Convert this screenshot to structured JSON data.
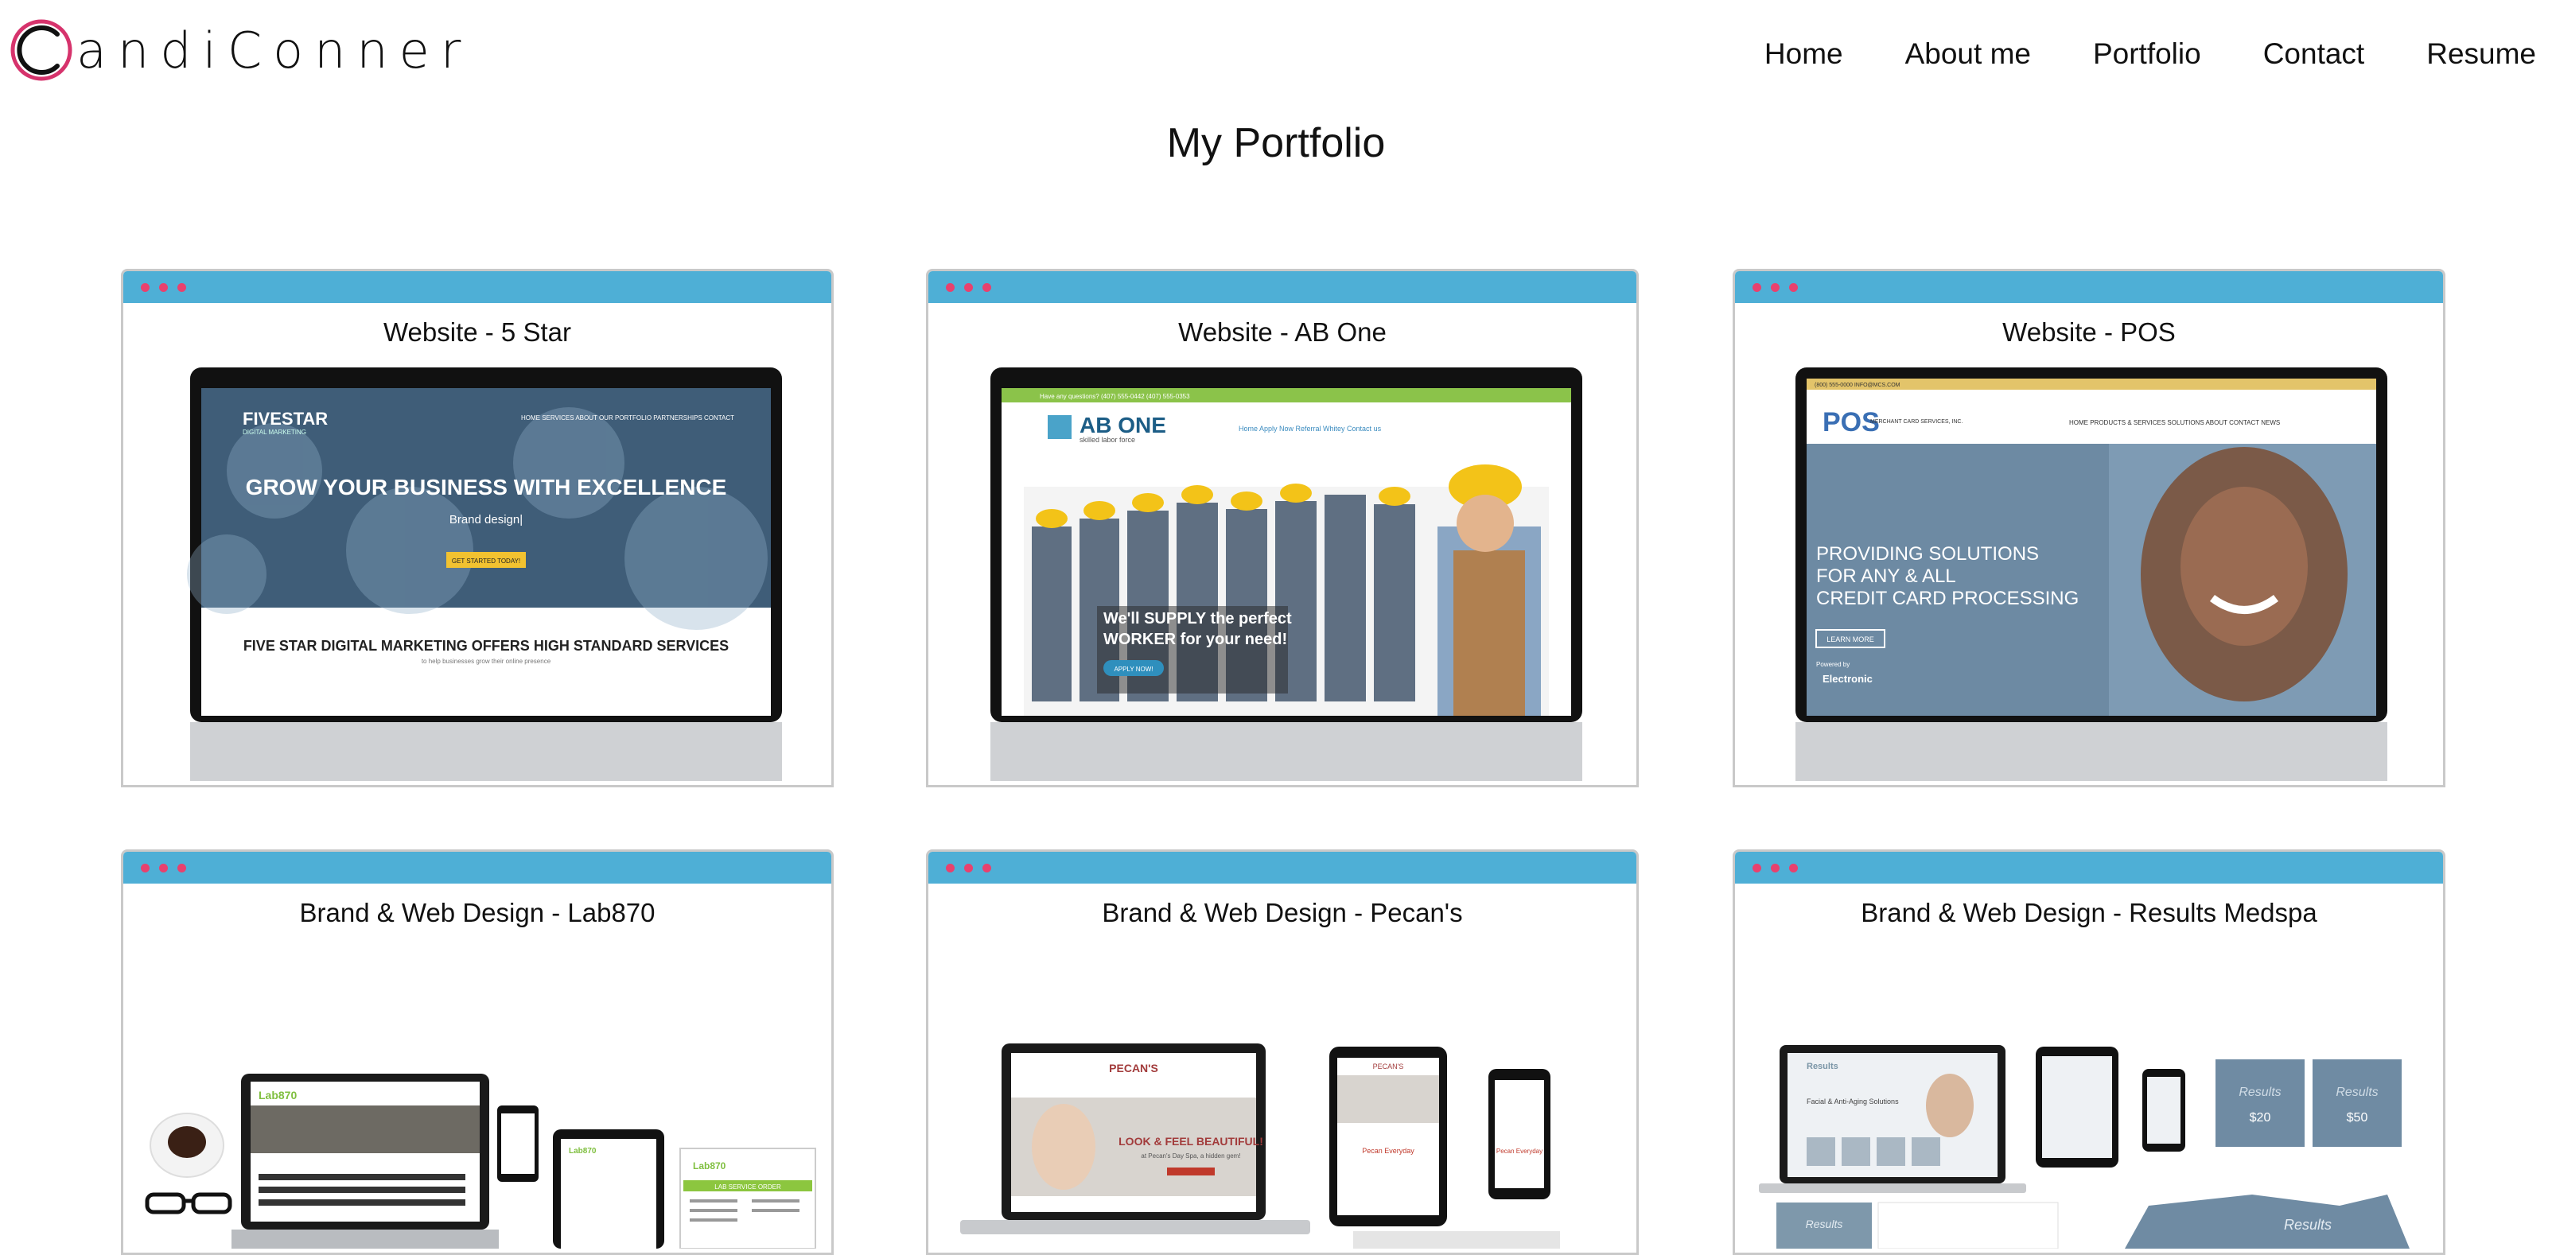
{
  "header": {
    "logo_text": "andiConner",
    "logo_letter": "C",
    "nav": [
      {
        "label": "Home"
      },
      {
        "label": "About me"
      },
      {
        "label": "Portfolio"
      },
      {
        "label": "Contact"
      },
      {
        "label": "Resume"
      }
    ]
  },
  "main": {
    "title": "My Portfolio",
    "cards": [
      {
        "title": "Website - 5 Star",
        "screen": {
          "brand": "FIVESTAR",
          "brand_sub": "DIGITAL MARKETING",
          "nav": "HOME   SERVICES   ABOUT   OUR PORTFOLIO   PARTNERSHIPS   CONTACT",
          "headline": "GROW YOUR BUSINESS WITH EXCELLENCE",
          "subhead": "Brand design|",
          "cta": "GET STARTED TODAY!",
          "lower_headline": "FIVE STAR DIGITAL MARKETING OFFERS HIGH STANDARD SERVICES",
          "lower_sub": "to help businesses grow their online presence"
        }
      },
      {
        "title": "Website - AB One",
        "screen": {
          "topbar": "Have any questions?   (407) 555-0442   (407) 555-0353",
          "brand": "AB ONE",
          "brand_sub": "skilled labor force",
          "nav": "Home     Apply Now     Referral Whitey     Contact us",
          "headline_1": "We'll SUPPLY the perfect",
          "headline_2": "WORKER for your need!",
          "cta": "APPLY NOW!"
        }
      },
      {
        "title": "Website - POS",
        "screen": {
          "topbar": "(800) 555-0000   INFO@MCS.COM",
          "brand": "POS",
          "brand_sub": "MERCHANT CARD SERVICES, INC.",
          "nav": "HOME   PRODUCTS & SERVICES   SOLUTIONS   ABOUT   CONTACT   NEWS",
          "headline_1": "PROVIDING SOLUTIONS",
          "headline_2": "FOR ANY & ALL",
          "headline_3": "CREDIT CARD PROCESSING",
          "cta": "LEARN MORE",
          "powered": "Powered by",
          "partner": "Electronic"
        }
      },
      {
        "title": "Brand & Web Design - Lab870",
        "brand": "Lab870",
        "form_title": "LAB SERVICE ORDER"
      },
      {
        "title": "Brand & Web Design - Pecan's",
        "brand": "PECAN'S",
        "headline": "LOOK & FEEL BEAUTIFUL!",
        "sub": "at Pecan's Day Spa, a hidden gem!",
        "badge": "Pecan Everyday"
      },
      {
        "title": "Brand & Web Design - Results Medspa",
        "brand": "Results",
        "headline": "Facial & Anti-Aging Solutions",
        "price_1": "$20",
        "price_2": "$50"
      }
    ]
  },
  "colors": {
    "card_bar": "#4eafd6",
    "window_dot": "#e8416e",
    "logo_ring": "#d6336c",
    "card_border": "#c9c9c9"
  },
  "icons": [
    "window-dot-icon",
    "logo-mark-icon"
  ]
}
